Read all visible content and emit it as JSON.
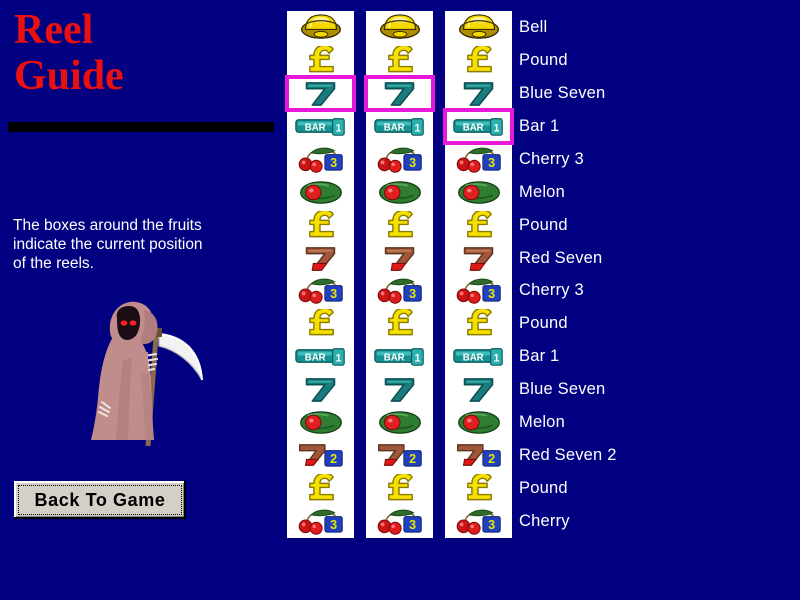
{
  "window": {
    "title": "Reel Guide",
    "background_color": "#000080"
  },
  "left_panel": {
    "title": "Reel\nGuide",
    "title_color": "#e81010",
    "rule_color": "#000000",
    "instructions": "The boxes around the fruits\nindicate the current position\nof the reels.",
    "instructions_color": "#ffffff",
    "mascot": {
      "name": "grim-reaper",
      "robe_color": "#c08c8c",
      "robe_shadow": "#a87878",
      "face_color": "#1a0d14",
      "eye_color": "#ff2020",
      "blade_color": "#f0f0f0",
      "handle_color": "#8a6a4a"
    },
    "button": {
      "label": "Back To Game",
      "face_color": "#d4d0c8",
      "text_color": "#000000"
    }
  },
  "reels": {
    "highlight_color": "#e818d8",
    "strip_background": "#ffffff",
    "rows": [
      {
        "index": 1,
        "label": "Bell",
        "symbols": [
          "bell",
          "bell",
          "bell"
        ],
        "highlighted": [
          false,
          false,
          false
        ]
      },
      {
        "index": 2,
        "label": "Pound",
        "symbols": [
          "pound",
          "pound",
          "pound"
        ],
        "highlighted": [
          false,
          false,
          false
        ]
      },
      {
        "index": 3,
        "label": "Blue Seven",
        "symbols": [
          "blue-seven",
          "blue-seven",
          "blue-seven"
        ],
        "highlighted": [
          true,
          true,
          false
        ]
      },
      {
        "index": 4,
        "label": "Bar 1",
        "symbols": [
          "bar-1",
          "bar-1",
          "bar-1"
        ],
        "highlighted": [
          false,
          false,
          true
        ]
      },
      {
        "index": 5,
        "label": "Cherry 3",
        "symbols": [
          "cherry-3",
          "cherry-3",
          "cherry-3"
        ],
        "highlighted": [
          false,
          false,
          false
        ]
      },
      {
        "index": 6,
        "label": "Melon",
        "symbols": [
          "melon",
          "melon",
          "melon"
        ],
        "highlighted": [
          false,
          false,
          false
        ]
      },
      {
        "index": 7,
        "label": "Pound",
        "symbols": [
          "pound",
          "pound",
          "pound"
        ],
        "highlighted": [
          false,
          false,
          false
        ]
      },
      {
        "index": 8,
        "label": "Red Seven",
        "symbols": [
          "red-seven",
          "red-seven",
          "red-seven"
        ],
        "highlighted": [
          false,
          false,
          false
        ]
      },
      {
        "index": 9,
        "label": "Cherry 3",
        "symbols": [
          "cherry-3",
          "cherry-3",
          "cherry-3"
        ],
        "highlighted": [
          false,
          false,
          false
        ]
      },
      {
        "index": 10,
        "label": "Pound",
        "symbols": [
          "pound",
          "pound",
          "pound"
        ],
        "highlighted": [
          false,
          false,
          false
        ]
      },
      {
        "index": 11,
        "label": "Bar 1",
        "symbols": [
          "bar-1",
          "bar-1",
          "bar-1"
        ],
        "highlighted": [
          false,
          false,
          false
        ]
      },
      {
        "index": 12,
        "label": "Blue Seven",
        "symbols": [
          "blue-seven",
          "blue-seven",
          "blue-seven"
        ],
        "highlighted": [
          false,
          false,
          false
        ]
      },
      {
        "index": 13,
        "label": "Melon",
        "symbols": [
          "melon",
          "melon",
          "melon"
        ],
        "highlighted": [
          false,
          false,
          false
        ]
      },
      {
        "index": 14,
        "label": "Red Seven 2",
        "symbols": [
          "red-seven-2",
          "red-seven-2",
          "red-seven-2"
        ],
        "highlighted": [
          false,
          false,
          false
        ]
      },
      {
        "index": 15,
        "label": "Pound",
        "symbols": [
          "pound",
          "pound",
          "pound"
        ],
        "highlighted": [
          false,
          false,
          false
        ]
      },
      {
        "index": 16,
        "label": "Cherry",
        "symbols": [
          "cherry-3",
          "cherry-3",
          "cherry-3"
        ],
        "highlighted": [
          false,
          false,
          false
        ]
      }
    ]
  },
  "symbol_colors": {
    "bell_body": "#f5d800",
    "bell_shade": "#b08c00",
    "bell_outline": "#3a2e00",
    "pound": "#f5e000",
    "pound_outline": "#8a7a00",
    "blue_seven": "#1a7d7d",
    "blue_seven_dark": "#0d4f52",
    "bar_teal": "#169090",
    "bar_text": "#ffffff",
    "red_seven": "#a05638",
    "red_seven_base": "#e01818",
    "cherry_red": "#c81414",
    "cherry_leaf": "#2f6b2a",
    "badge_blue": "#2040c0",
    "melon_green": "#2e7d32",
    "melon_flesh": "#e02020"
  }
}
